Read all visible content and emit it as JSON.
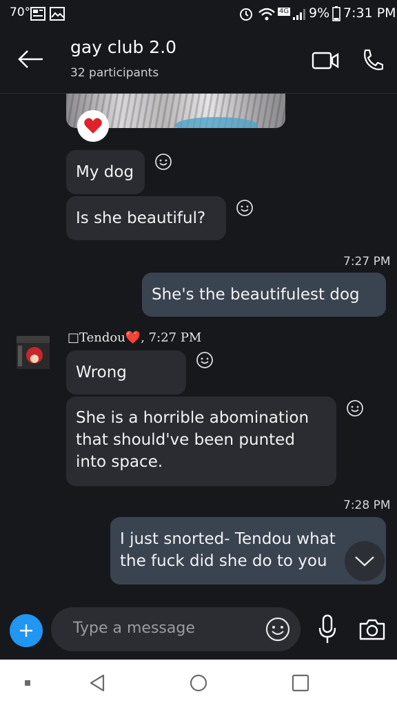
{
  "status_bar": {
    "temperature": "70°",
    "battery": "9%",
    "time": "7:31 PM",
    "network_badge": "4G"
  },
  "header": {
    "title": "gay club 2.0",
    "subtitle": "32 participants"
  },
  "messages": {
    "m1": "My dog",
    "m2": "Is she beautiful?",
    "ts1": "7:27 PM",
    "m3": "She's the beautifulest dog",
    "sender": "□Tendou❤️",
    "sender_time": ", 7:27 PM",
    "m4": "Wrong",
    "m5_line1": "She is a horrible abomination",
    "m5_line2": "that should've been punted",
    "m5_line3": "into space.",
    "ts2": "7:28 PM",
    "m6_line1": "I just snorted- Tendou what",
    "m6_line2": "the fuck did she do to you"
  },
  "composer": {
    "placeholder": "Type a message"
  },
  "icons": {
    "back": "arrow-left-icon",
    "video": "video-camera-icon",
    "call": "phone-icon",
    "react": "smiley-icon",
    "add": "plus-icon",
    "mic": "microphone-icon",
    "camera": "camera-icon",
    "heart": "heart-icon"
  },
  "colors": {
    "background": "#17181c",
    "bubble_in": "#2a2c32",
    "bubble_out": "#3a4350",
    "add_button": "#2196f3",
    "heart": "#e0202a"
  }
}
